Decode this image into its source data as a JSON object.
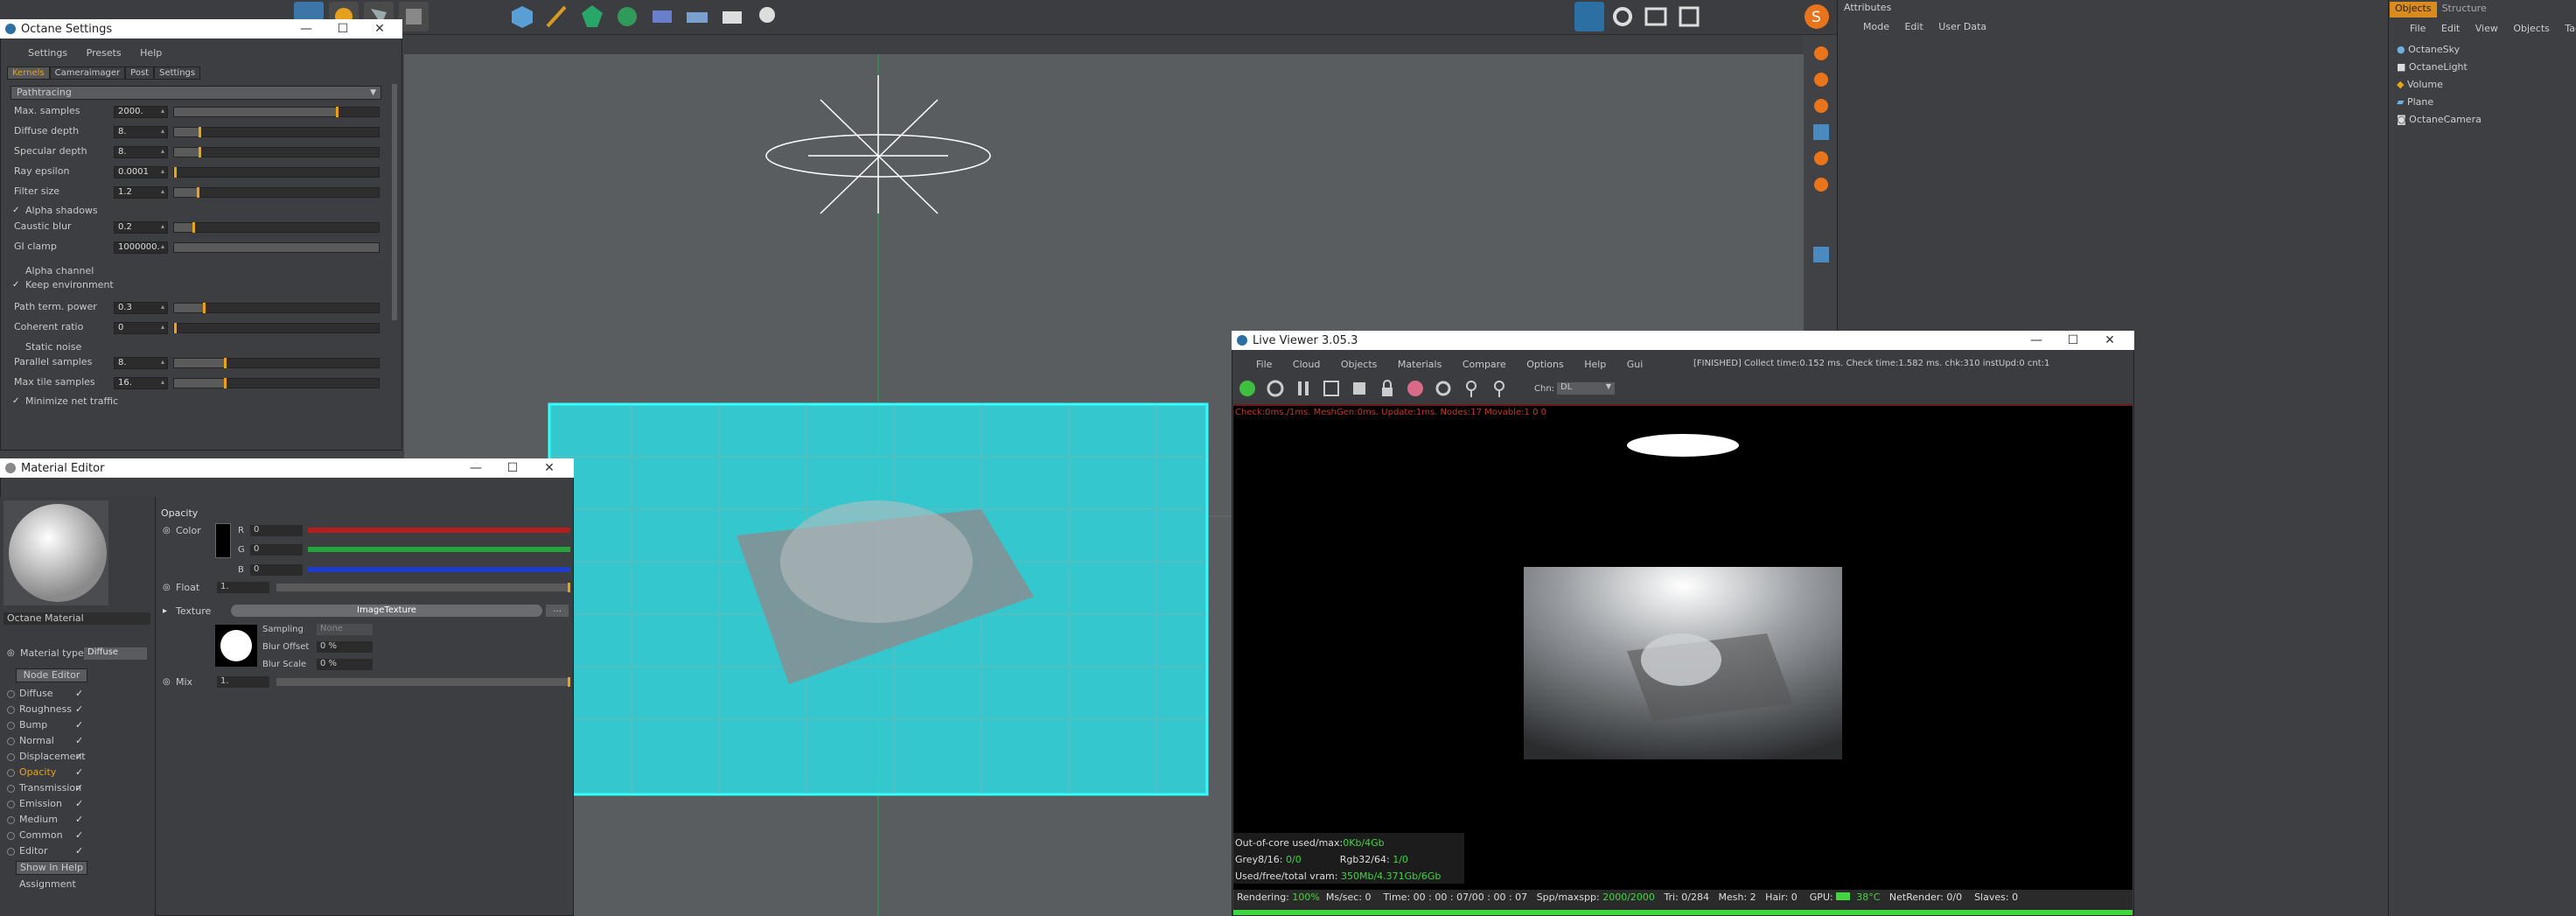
{
  "app": {
    "top_menu": {
      "file": "File",
      "edit": "Edit",
      "view": "View",
      "objects": "Objects",
      "tags": "Tags"
    },
    "attr_menu": {
      "mode": "Mode",
      "edit": "Edit",
      "user_data": "User Data"
    },
    "panel_tabs": {
      "objects": "Objects",
      "structure": "Structure"
    },
    "attributes_title": "Attributes"
  },
  "octane_settings": {
    "title": "Octane Settings",
    "menu": [
      "Settings",
      "Presets",
      "Help"
    ],
    "tabs": [
      "Kernels",
      "Cameraimager",
      "Post",
      "Settings"
    ],
    "kernel": "Pathtracing",
    "rows": [
      {
        "label": "Max. samples",
        "value": "2000.",
        "fill": 0.8
      },
      {
        "label": "Diffuse depth",
        "value": "8.",
        "fill": 0.13
      },
      {
        "label": "Specular depth",
        "value": "8.",
        "fill": 0.13
      },
      {
        "label": "Ray epsilon",
        "value": "0.0001",
        "fill": 0.0
      },
      {
        "label": "Filter size",
        "value": "1.2",
        "fill": 0.12
      },
      {
        "label": "Caustic blur",
        "value": "0.2",
        "fill": 0.1
      },
      {
        "label": "GI clamp",
        "value": "1000000.",
        "fill": 1.0
      },
      {
        "label": "Path term. power",
        "value": "0.3",
        "fill": 0.15
      },
      {
        "label": "Coherent ratio",
        "value": "0",
        "fill": 0.0
      },
      {
        "label": "Parallel samples",
        "value": "8.",
        "fill": 0.25
      },
      {
        "label": "Max tile samples",
        "value": "16.",
        "fill": 0.25
      }
    ],
    "checks": {
      "alpha_shadows": "Alpha shadows",
      "alpha_channel": "Alpha channel",
      "keep_environment": "Keep environment",
      "static_noise": "Static noise",
      "minimize_net": "Minimize net traffic"
    }
  },
  "material_editor": {
    "title": "Material Editor",
    "material_name": "Octane Material",
    "material_type_label": "Material type",
    "material_type": "Diffuse",
    "node_editor": "Node Editor",
    "channels": [
      "Diffuse",
      "Roughness",
      "Bump",
      "Normal",
      "Displacement",
      "Opacity",
      "Transmission",
      "Emission",
      "Medium",
      "Common",
      "Editor"
    ],
    "show_in_help": "Show In Help",
    "assignment": "Assignment",
    "section": "Opacity",
    "color_label": "Color",
    "r": "R",
    "g": "G",
    "b": "B",
    "r_val": "0",
    "g_val": "0",
    "b_val": "0",
    "float_label": "Float",
    "float_val": "1.",
    "texture_label": "Texture",
    "texture_name": "ImageTexture",
    "sampling_label": "Sampling",
    "sampling_val": "None",
    "blur_offset_label": "Blur Offset",
    "blur_offset_val": "0 %",
    "blur_scale_label": "Blur Scale",
    "blur_scale_val": "0 %",
    "mix_label": "Mix",
    "mix_val": "1."
  },
  "live_viewer": {
    "title": "Live Viewer 3.05.3",
    "menu": [
      "File",
      "Cloud",
      "Objects",
      "Materials",
      "Compare",
      "Options",
      "Help",
      "Gui"
    ],
    "status": "[FINISHED] Collect time:0.152 ms.  Check time:1.582 ms.  chk:310  instUpd:0  cnt:1",
    "chn_label": "Chn:",
    "chn_value": "DL",
    "check_line": "Check:0ms./1ms. MeshGen:0ms. Update:1ms. Nodes:17 Movable:1  0  0",
    "outofcore_label": "Out-of-core used/max:",
    "outofcore_val": "0Kb/4Gb",
    "grey_label": "Grey8/16:",
    "grey_val": "0/0",
    "rgb_label": "Rgb32/64:",
    "rgb_val": "1/0",
    "vram_label": "Used/free/total vram:",
    "vram_val": "350Mb/4.371Gb/6Gb",
    "bottom": {
      "rendering_label": "Rendering:",
      "rendering_val": "100%",
      "mss_label": "Ms/sec:",
      "mss_val": "0",
      "time_label": "Time:",
      "time_val": "00 : 00 : 07/00 : 00 : 07",
      "spp_label": "Spp/maxspp:",
      "spp_val": "2000/2000",
      "tri_label": "Tri:",
      "tri_val": "0/284",
      "mesh_label": "Mesh:",
      "mesh_val": "2",
      "hair_label": "Hair:",
      "hair_val": "0",
      "gpu_label": "GPU:",
      "gpu_temp": "38°C",
      "net_label": "NetRender:",
      "net_val": "0/0",
      "slaves_label": "Slaves:",
      "slaves_val": "0"
    },
    "progress": 1.0
  },
  "objects": [
    {
      "name": "OctaneSky"
    },
    {
      "name": "OctaneLight"
    },
    {
      "name": "Volume"
    },
    {
      "name": "Plane"
    },
    {
      "name": "OctaneCamera"
    }
  ],
  "colors": {
    "accent": "#e8a319",
    "cyan": "#33ffff",
    "green_progress": "#3fd63f",
    "tab_orange": "#d98c1c"
  }
}
